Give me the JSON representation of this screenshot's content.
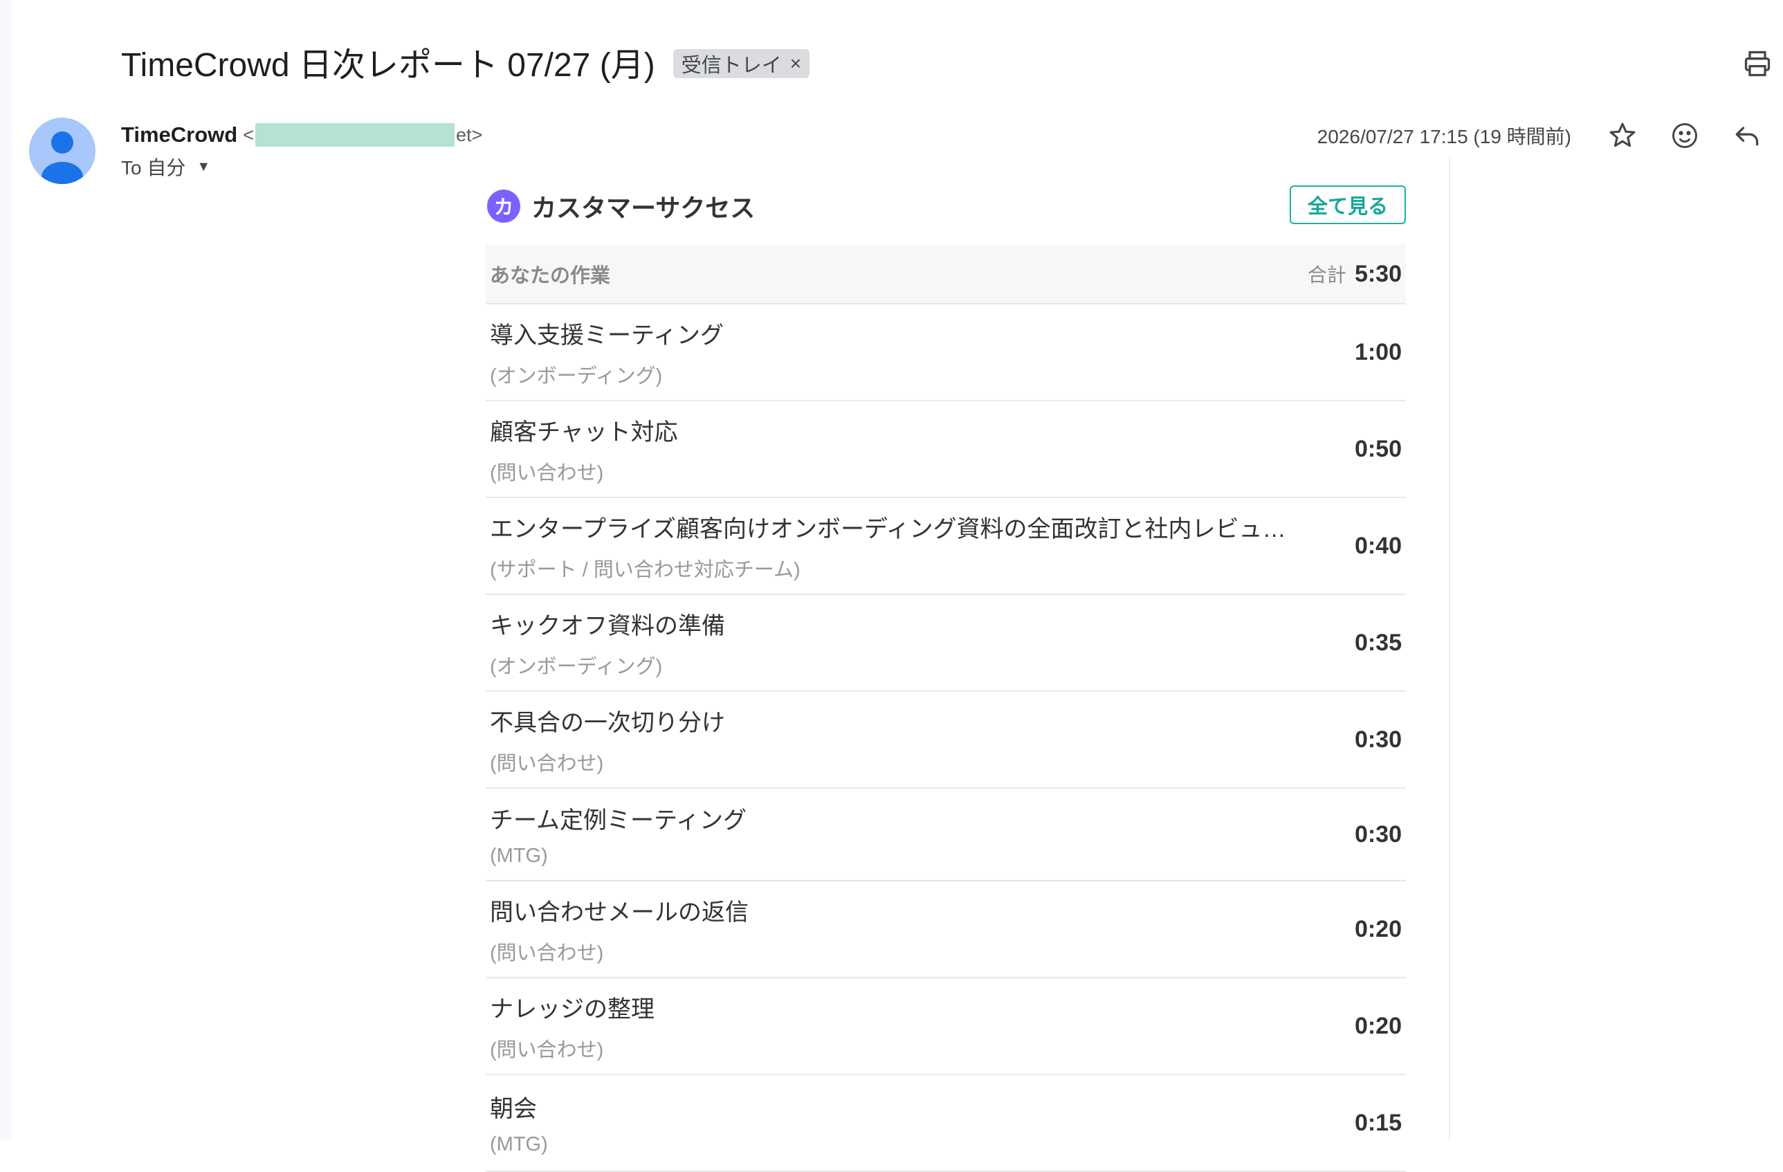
{
  "email": {
    "subject": "TimeCrowd 日次レポート 07/27 (月)",
    "label": "受信トレイ",
    "label_close": "×",
    "sender_name": "TimeCrowd",
    "sender_email_prefix": "<",
    "sender_email_suffix": "et>",
    "to_label": "To 自分",
    "datetime": "2026/07/27 17:15 (19 時間前)"
  },
  "icons": {
    "print": "printer-icon",
    "star": "star-icon",
    "emoji": "smiley-icon",
    "reply": "reply-icon",
    "avatar": "person-icon"
  },
  "report": {
    "team_initial": "カ",
    "team_name": "カスタマーサクセス",
    "view_all": "全て見る",
    "summary_label": "あなたの作業",
    "total_label": "合計",
    "total_value": "5:30",
    "tasks": [
      {
        "name": "導入支援ミーティング",
        "category": "(オンボーディング)",
        "time": "1:00"
      },
      {
        "name": "顧客チャット対応",
        "category": "(問い合わせ)",
        "time": "0:50"
      },
      {
        "name": "エンタープライズ顧客向けオンボーディング資料の全面改訂と社内レビュー...",
        "category": "(サポート / 問い合わせ対応チーム)",
        "time": "0:40"
      },
      {
        "name": "キックオフ資料の準備",
        "category": "(オンボーディング)",
        "time": "0:35"
      },
      {
        "name": "不具合の一次切り分け",
        "category": "(問い合わせ)",
        "time": "0:30"
      },
      {
        "name": "チーム定例ミーティング",
        "category": "(MTG)",
        "time": "0:30"
      },
      {
        "name": "問い合わせメールの返信",
        "category": "(問い合わせ)",
        "time": "0:20"
      },
      {
        "name": "ナレッジの整理",
        "category": "(問い合わせ)",
        "time": "0:20"
      },
      {
        "name": "朝会",
        "category": "(MTG)",
        "time": "0:15"
      }
    ]
  },
  "colors": {
    "accent_teal": "#19b2a0",
    "team_badge": "#7b61ff",
    "avatar_bg": "#a8c7fa",
    "avatar_fg": "#1a73e8",
    "redaction": "#b4e2d3"
  }
}
